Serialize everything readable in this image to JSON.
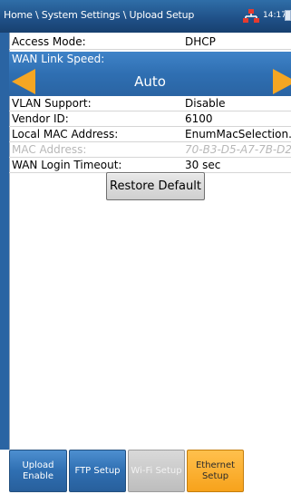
{
  "header": {
    "path": "Home \\ System Settings \\ Upload Setup",
    "time": "14:17"
  },
  "settings": {
    "access_mode": {
      "label": "Access Mode:",
      "value": "DHCP"
    },
    "wan_link_speed": {
      "label": "WAN Link Speed:",
      "value": "Auto"
    },
    "vlan_support": {
      "label": "VLAN Support:",
      "value": "Disable"
    },
    "vendor_id": {
      "label": "Vendor ID:",
      "value": "6100"
    },
    "local_mac": {
      "label": "Local MAC Address:",
      "value": "EnumMacSelection..."
    },
    "mac_address": {
      "label": "MAC Address:",
      "value": "70-B3-D5-A7-7B-D2",
      "enabled": false
    },
    "wan_login_timeout": {
      "label": "WAN Login Timeout:",
      "value": "30 sec"
    }
  },
  "restore_label": "Restore Default",
  "tabs": [
    {
      "label": "Upload Enable",
      "state": "normal"
    },
    {
      "label": "FTP Setup",
      "state": "normal"
    },
    {
      "label": "Wi-Fi Setup",
      "state": "disabled"
    },
    {
      "label": "Ethernet Setup",
      "state": "active"
    }
  ],
  "colors": {
    "header_blue": "#1f4f86",
    "accent_orange": "#f5a623",
    "tab_blue": "#2f6fb2"
  }
}
